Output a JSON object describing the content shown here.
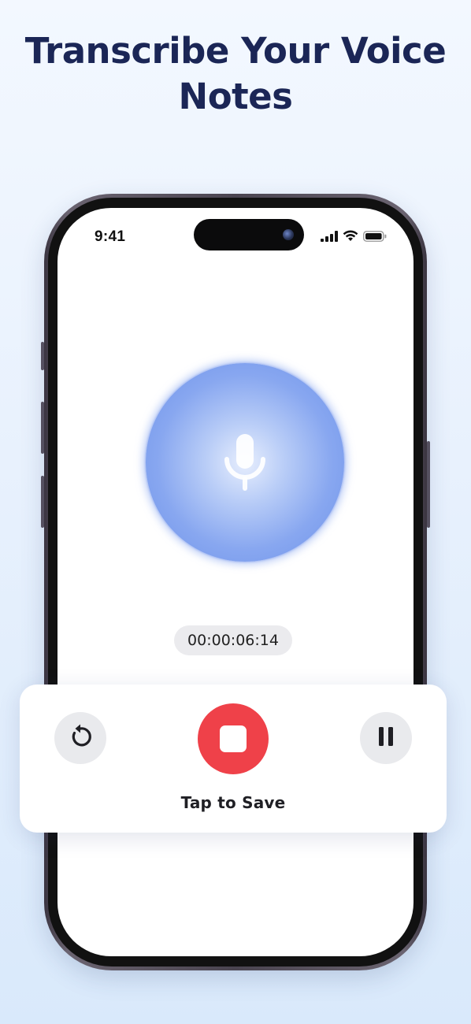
{
  "headline": {
    "line1": "Transcribe Your Voice",
    "line2": "Notes"
  },
  "status_bar": {
    "time": "9:41",
    "icons": [
      "cellular-signal-icon",
      "wifi-icon",
      "battery-icon"
    ]
  },
  "recorder": {
    "icon": "microphone-icon",
    "elapsed": "00:00:06:14"
  },
  "controls": {
    "restart_icon": "restart-icon",
    "stop_icon": "stop-icon",
    "pause_icon": "pause-icon",
    "label": "Tap to Save"
  },
  "colors": {
    "headline": "#1b2656",
    "stop_button": "#ef4149",
    "orb": "#88a7f0",
    "secondary_button": "#e9eaed"
  }
}
